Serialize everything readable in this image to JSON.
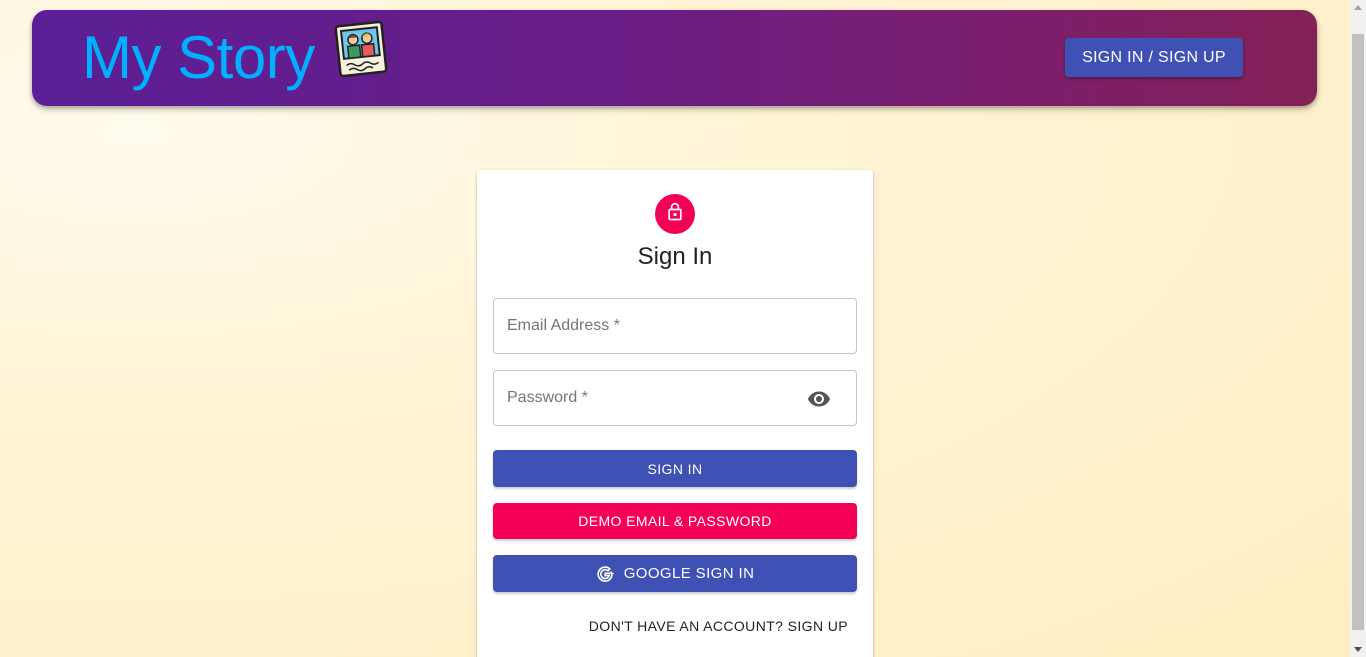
{
  "header": {
    "brand": "My Story",
    "brand_icon": "photo-frame-icon",
    "auth_button_label": "SIGN IN / SIGN UP"
  },
  "signin_card": {
    "avatar_icon": "lock-icon",
    "title": "Sign In",
    "email_placeholder": "Email Address *",
    "password_placeholder": "Password *",
    "password_toggle_icon": "eye-icon",
    "signin_label": "SIGN IN",
    "demo_label": "DEMO EMAIL & PASSWORD",
    "google_icon": "google-icon",
    "google_label": "GOOGLE SIGN IN",
    "signup_link": "DON'T HAVE AN ACCOUNT? SIGN UP"
  },
  "colors": {
    "primary": "#3f51b5",
    "secondary": "#f50057",
    "brand_text": "#00b0ff",
    "appbar_start": "#5b1f96",
    "appbar_end": "#832157"
  }
}
